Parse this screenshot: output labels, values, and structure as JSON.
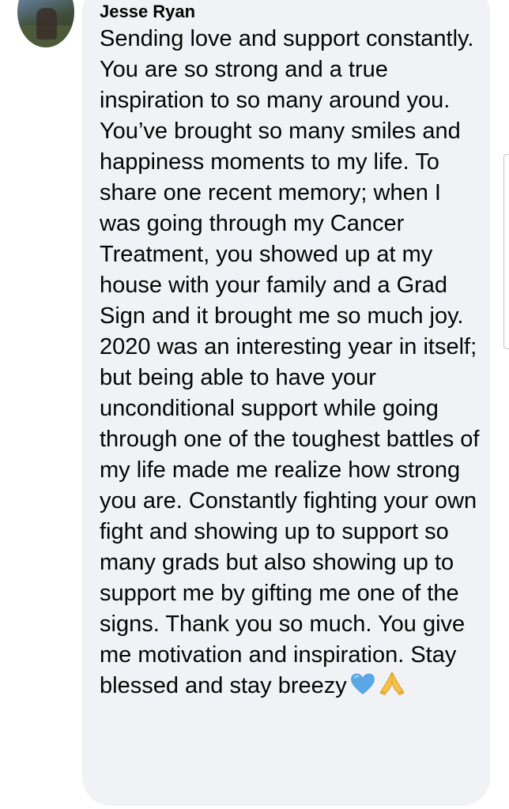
{
  "comment": {
    "author": "Jesse Ryan",
    "text": "Sending love and support constantly. You are so strong and a true inspiration to so many around you. You’ve brought so many smiles and happiness moments to my life. To share one recent memory; when I was going through my Cancer Treatment, you showed up at my house with your family and a Grad Sign and it brought me so much joy. 2020 was an interesting year in itself; but being able to have your unconditional support while going through one of the toughest battles of my life made me realize how strong you are. Constantly fighting your own fight and showing up to support so many grads but also showing up to support me by gifting me one of the signs. Thank you so much. You give me motivation and inspiration. Stay blessed and stay breezy",
    "emojis": [
      "blue-heart-icon",
      "folded-hands-icon"
    ]
  },
  "colors": {
    "bubble": "#f0f2f5",
    "text": "#050505",
    "heart": "#5aa7e8",
    "hands": "#f7c24a"
  }
}
